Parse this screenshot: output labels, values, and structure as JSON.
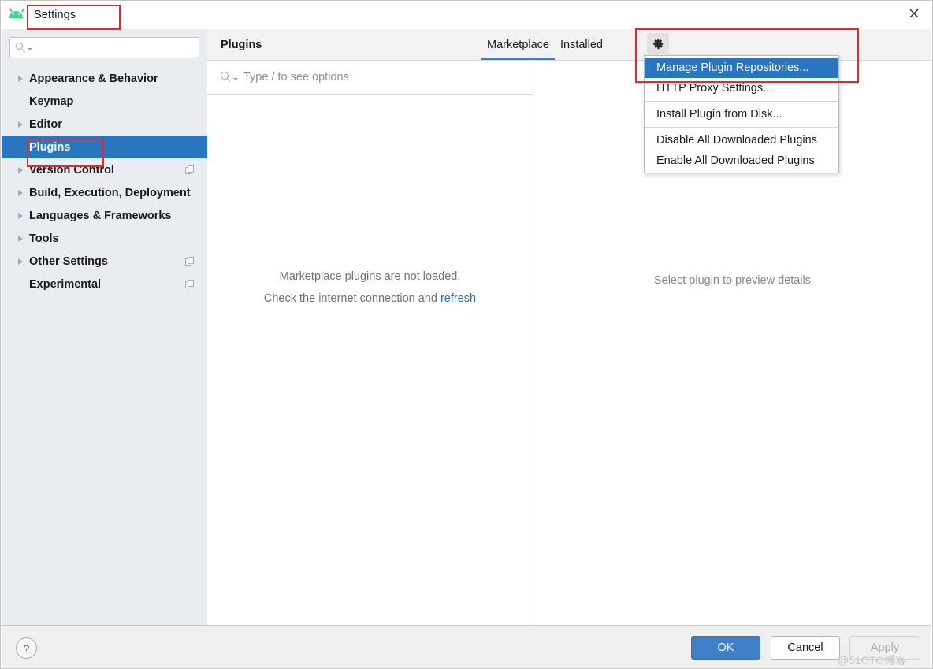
{
  "window": {
    "title": "Settings",
    "app_icon": "android-studio-icon",
    "close_icon": "close-icon"
  },
  "sidebar": {
    "search": {
      "placeholder": "",
      "value": "",
      "icon": "search-icon"
    },
    "items": [
      {
        "label": "Appearance & Behavior",
        "expandable": true,
        "selected": false,
        "copy_icon": false
      },
      {
        "label": "Keymap",
        "expandable": false,
        "selected": false,
        "copy_icon": false
      },
      {
        "label": "Editor",
        "expandable": true,
        "selected": false,
        "copy_icon": false
      },
      {
        "label": "Plugins",
        "expandable": false,
        "selected": true,
        "copy_icon": false
      },
      {
        "label": "Version Control",
        "expandable": true,
        "selected": false,
        "copy_icon": true
      },
      {
        "label": "Build, Execution, Deployment",
        "expandable": true,
        "selected": false,
        "copy_icon": false
      },
      {
        "label": "Languages & Frameworks",
        "expandable": true,
        "selected": false,
        "copy_icon": false
      },
      {
        "label": "Tools",
        "expandable": true,
        "selected": false,
        "copy_icon": false
      },
      {
        "label": "Other Settings",
        "expandable": true,
        "selected": false,
        "copy_icon": true
      },
      {
        "label": "Experimental",
        "expandable": false,
        "selected": false,
        "copy_icon": true
      }
    ]
  },
  "main": {
    "title": "Plugins",
    "tabs": [
      {
        "label": "Marketplace",
        "active": true
      },
      {
        "label": "Installed",
        "active": false
      }
    ],
    "gear_icon": "gear-icon",
    "plugin_search": {
      "placeholder": "Type / to see options",
      "value": "",
      "icon": "search-icon"
    },
    "empty_state": {
      "line1": "Marketplace plugins are not loaded.",
      "line2_prefix": "Check the internet connection and ",
      "line2_link": "refresh"
    },
    "detail_placeholder": "Select plugin to preview details"
  },
  "menu": {
    "items": [
      {
        "label": "Manage Plugin Repositories...",
        "highlight": true,
        "separator_after": false
      },
      {
        "label": "HTTP Proxy Settings...",
        "highlight": false,
        "separator_after": true
      },
      {
        "label": "Install Plugin from Disk...",
        "highlight": false,
        "separator_after": true
      },
      {
        "label": "Disable All Downloaded Plugins",
        "highlight": false,
        "separator_after": false
      },
      {
        "label": "Enable All Downloaded Plugins",
        "highlight": false,
        "separator_after": false
      }
    ]
  },
  "footer": {
    "help_label": "?",
    "ok_label": "OK",
    "cancel_label": "Cancel",
    "apply_label": "Apply",
    "apply_enabled": false
  },
  "watermark": "@51CTO博客",
  "colors": {
    "accent_blue": "#2a75c0",
    "tab_underline": "#3f7fc8",
    "link_blue": "#2b6bbd",
    "annotation_red": "#e8272c",
    "sidebar_bg": "#e9edf1",
    "android_green": "#3ddc84"
  }
}
